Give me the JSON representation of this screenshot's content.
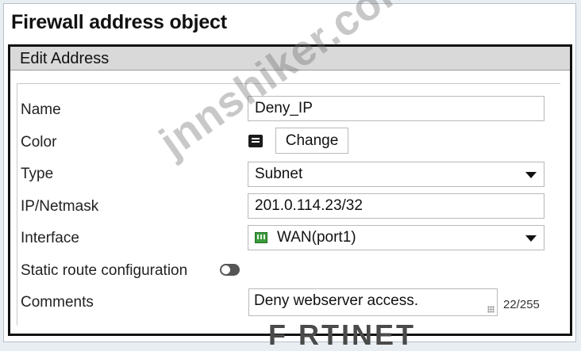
{
  "page": {
    "title": "Firewall address object"
  },
  "dialog": {
    "header": "Edit Address"
  },
  "form": {
    "name": {
      "label": "Name",
      "value": "Deny_IP"
    },
    "color": {
      "label": "Color",
      "button": "Change",
      "icon": "color-swatch-icon"
    },
    "type": {
      "label": "Type",
      "value": "Subnet"
    },
    "ip_netmask": {
      "label": "IP/Netmask",
      "value": "201.0.114.23/32"
    },
    "interface": {
      "label": "Interface",
      "value": "WAN(port1)",
      "icon": "network-port-icon"
    },
    "static_route": {
      "label": "Static route configuration",
      "enabled": false
    },
    "comments": {
      "label": "Comments",
      "value": "Deny webserver access.",
      "counter": "22/255"
    }
  },
  "overlay": {
    "watermark": "jnnshiker.com",
    "logo_text": "F  RTINET",
    "logo_mark": "■"
  },
  "colors": {
    "toggle_off": "#555555",
    "port_icon": "#3c9b3c",
    "logo_red": "#cc1f1f"
  }
}
